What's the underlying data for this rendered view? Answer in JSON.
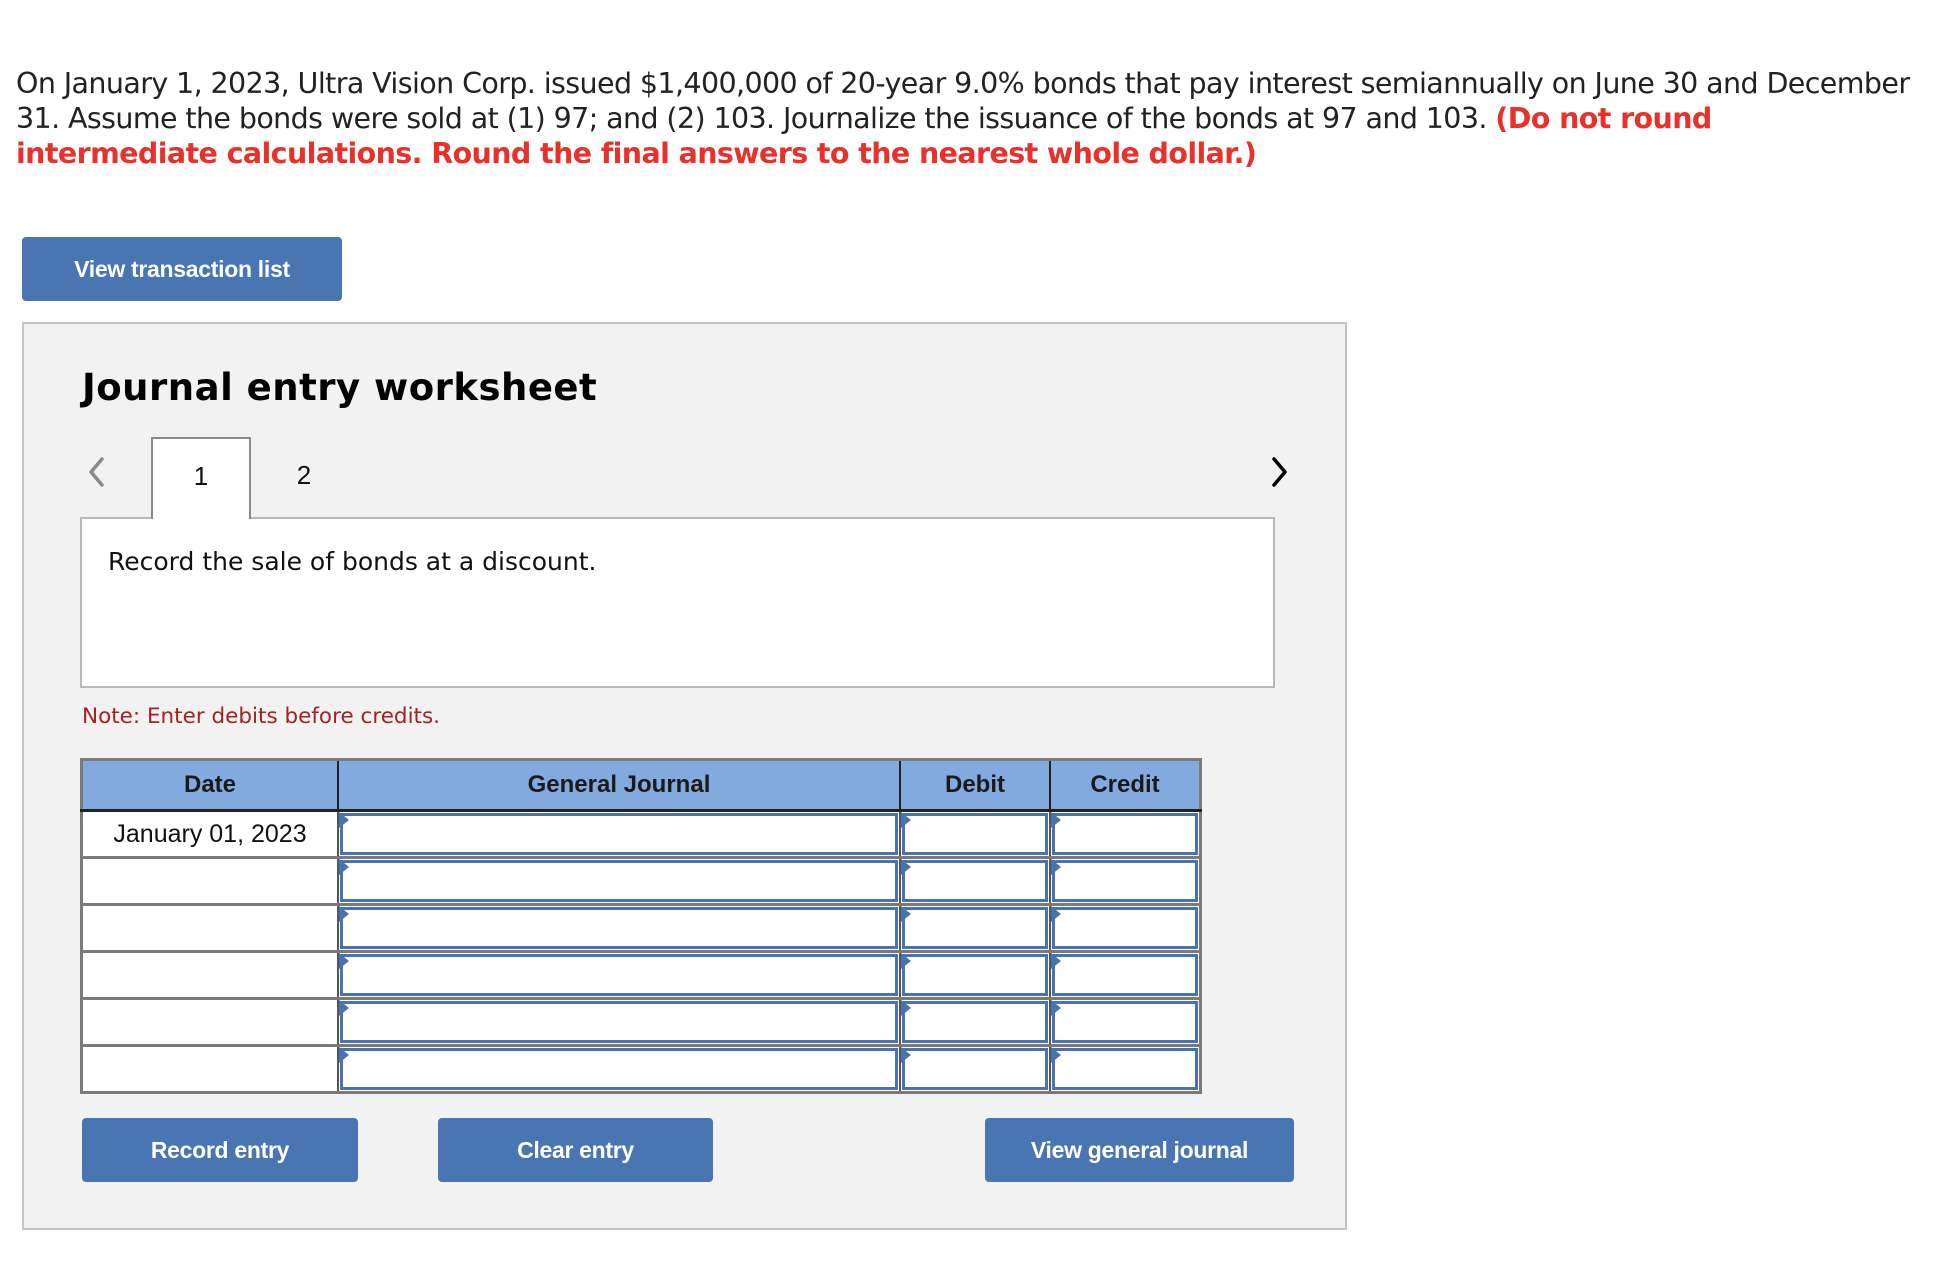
{
  "question": {
    "text_plain": "On January 1, 2023, Ultra Vision Corp. issued $1,400,000 of 20-year 9.0% bonds that pay interest semiannually on June 30 and December 31. Assume the bonds were sold at (1) 97; and (2) 103. Journalize the issuance of the bonds at 97 and 103. ",
    "text_emphasis": "(Do not round intermediate calculations. Round the final answers to the nearest whole dollar.)"
  },
  "buttons": {
    "view_transaction_list": "View transaction list",
    "record_entry": "Record entry",
    "clear_entry": "Clear entry",
    "view_general_journal": "View general journal"
  },
  "worksheet": {
    "title": "Journal entry worksheet",
    "tabs": [
      {
        "label": "1",
        "active": true
      },
      {
        "label": "2",
        "active": false
      }
    ],
    "prev_icon": "chevron-left-icon",
    "next_icon": "chevron-right-icon",
    "instruction": "Record the sale of bonds at a discount.",
    "note": "Note: Enter debits before credits."
  },
  "journal": {
    "columns": [
      "Date",
      "General Journal",
      "Debit",
      "Credit"
    ],
    "rows": [
      {
        "date": "January 01, 2023",
        "account": "",
        "debit": "",
        "credit": ""
      },
      {
        "date": "",
        "account": "",
        "debit": "",
        "credit": ""
      },
      {
        "date": "",
        "account": "",
        "debit": "",
        "credit": ""
      },
      {
        "date": "",
        "account": "",
        "debit": "",
        "credit": ""
      },
      {
        "date": "",
        "account": "",
        "debit": "",
        "credit": ""
      },
      {
        "date": "",
        "account": "",
        "debit": "",
        "credit": ""
      }
    ]
  },
  "colors": {
    "button": "#4a75b3",
    "header": "#83aadf",
    "emphasis": "#e8312a",
    "note": "#a3231f",
    "input_border": "#4a72b0"
  }
}
